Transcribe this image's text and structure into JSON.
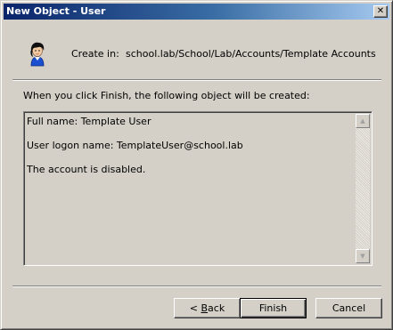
{
  "window": {
    "title": "New Object - User",
    "close_glyph": "✕"
  },
  "header": {
    "icon": "user-icon",
    "create_in_label": "Create in:",
    "create_in_path": "school.lab/School/Lab/Accounts/Template Accounts"
  },
  "body": {
    "info_text": "When you click Finish, the following object will be created:",
    "summary_lines": [
      "Full name: Template User",
      "User logon name: TemplateUser@school.lab",
      "The account is disabled."
    ]
  },
  "buttons": {
    "back_prefix": "< ",
    "back_mnemonic": "B",
    "back_rest": "ack",
    "finish": "Finish",
    "cancel": "Cancel"
  },
  "scrollbar": {
    "up_glyph": "▲",
    "down_glyph": "▼"
  },
  "colors": {
    "title_active": "#0a246a",
    "dialog_face": "#d4d0c8"
  }
}
